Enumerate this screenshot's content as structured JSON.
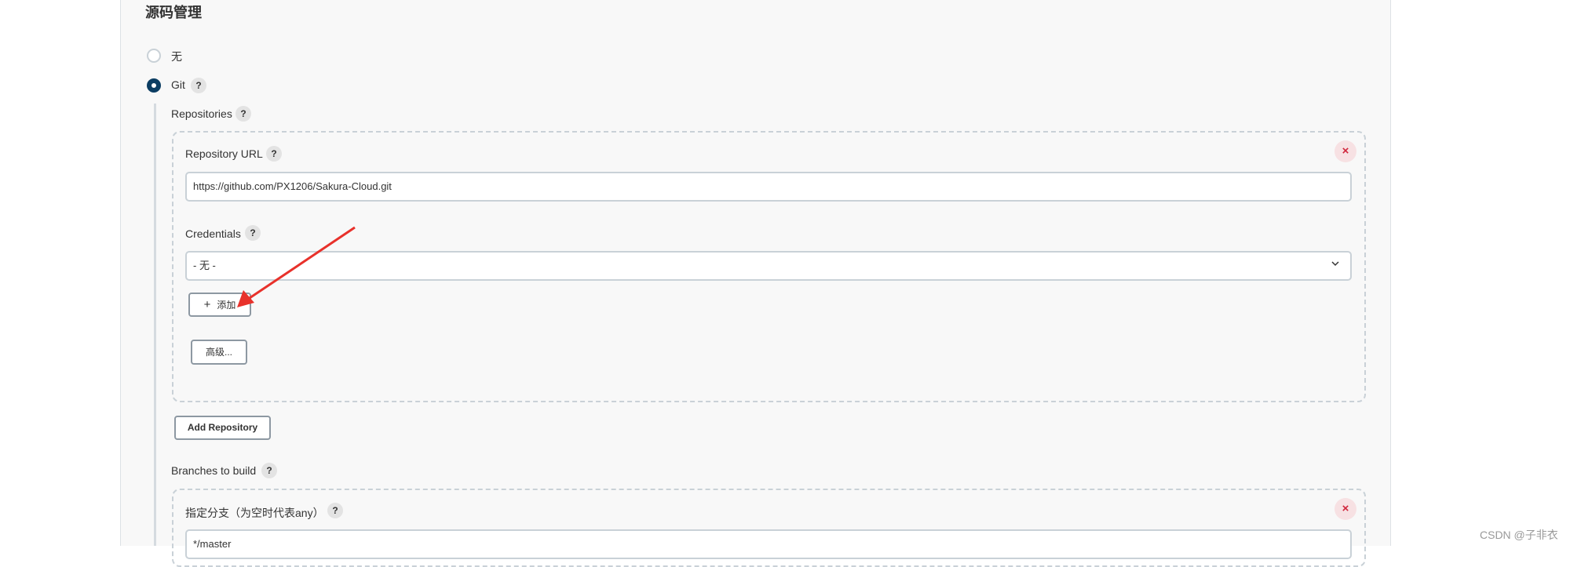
{
  "section": {
    "title": "源码管理"
  },
  "scm_options": [
    {
      "label": "无",
      "selected": false
    },
    {
      "label": "Git",
      "selected": true,
      "help": "?"
    }
  ],
  "repositories": {
    "label": "Repositories",
    "help": "?",
    "items": [
      {
        "url_label": "Repository URL",
        "url_help": "?",
        "url_value": "https://github.com/PX1206/Sakura-Cloud.git",
        "credentials_label": "Credentials",
        "credentials_help": "?",
        "credentials_selected": "- 无 -",
        "add_button": {
          "icon": "plus-icon",
          "label": "添加"
        },
        "advanced_button": "高级...",
        "remove_icon": "close-icon",
        "remove_glyph": "×"
      }
    ],
    "add_repository_button": "Add Repository"
  },
  "branches": {
    "label": "Branches to build",
    "help": "?",
    "items": [
      {
        "spec_label": "指定分支（为空时代表any）",
        "spec_help": "?",
        "spec_value": "*/master",
        "remove_glyph": "×"
      }
    ]
  },
  "annotation": {
    "arrow_color": "#e8312b"
  },
  "watermark": "CSDN @子非衣",
  "colors": {
    "accent": "#0b3d62",
    "remove_bg": "#f7e1e3",
    "remove_fg": "#d0253b"
  }
}
